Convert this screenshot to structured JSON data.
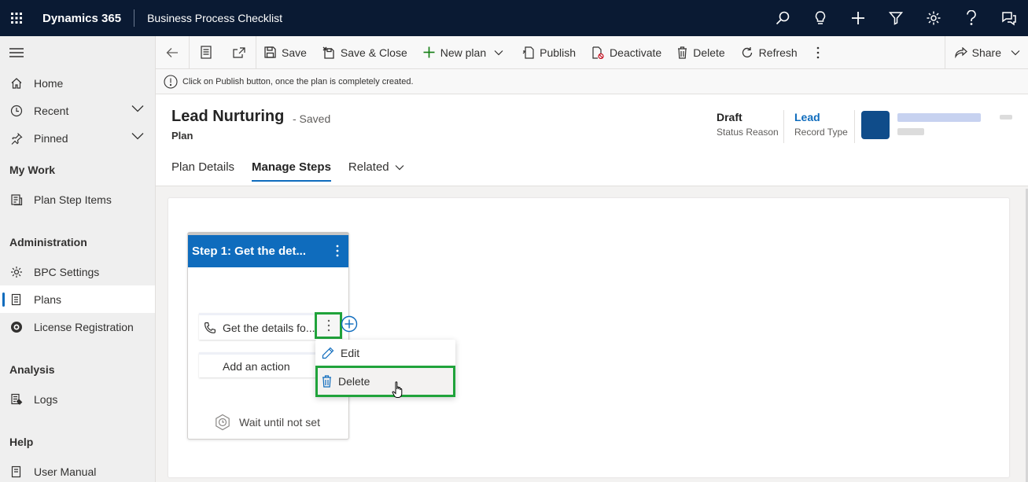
{
  "topbar": {
    "app_name": "Dynamics 365",
    "app_title": "Business Process Checklist",
    "icons": [
      "search-icon",
      "lightbulb-icon",
      "plus-icon",
      "filter-icon",
      "gear-icon",
      "help-icon",
      "chat-icon"
    ]
  },
  "sidebar": {
    "items": [
      {
        "label": "Home",
        "icon": "home-icon"
      },
      {
        "label": "Recent",
        "icon": "clock-icon"
      },
      {
        "label": "Pinned",
        "icon": "pin-icon"
      }
    ],
    "sections": [
      {
        "title": "My Work",
        "items": [
          {
            "label": "Plan Step Items",
            "icon": "checklist-icon"
          }
        ]
      },
      {
        "title": "Administration",
        "items": [
          {
            "label": "BPC Settings",
            "icon": "gear-icon"
          },
          {
            "label": "Plans",
            "icon": "document-icon",
            "selected": true
          },
          {
            "label": "License Registration",
            "icon": "license-icon"
          }
        ]
      },
      {
        "title": "Analysis",
        "items": [
          {
            "label": "Logs",
            "icon": "log-icon"
          }
        ]
      },
      {
        "title": "Help",
        "items": [
          {
            "label": "User Manual",
            "icon": "book-icon"
          }
        ]
      }
    ]
  },
  "commandbar": {
    "save": "Save",
    "save_close": "Save & Close",
    "new_plan": "New plan",
    "publish": "Publish",
    "deactivate": "Deactivate",
    "delete": "Delete",
    "refresh": "Refresh",
    "share": "Share"
  },
  "notice": {
    "text": "Click on Publish button, once the plan is completely created."
  },
  "header": {
    "title": "Lead Nurturing",
    "saved": "- Saved",
    "entity": "Plan",
    "status_value": "Draft",
    "status_label": "Status Reason",
    "record_type_value": "Lead",
    "record_type_label": "Record Type",
    "tabs": [
      "Plan Details",
      "Manage Steps",
      "Related"
    ]
  },
  "step": {
    "title": "Step 1: Get the det...",
    "action_label": "Get the details fo...",
    "add_action": "Add an action",
    "wait": "Wait until not set"
  },
  "context_menu": {
    "edit": "Edit",
    "delete": "Delete"
  },
  "colors": {
    "topbar": "#0a1a33",
    "accent": "#0f6cbd",
    "highlight": "#20a33b"
  }
}
